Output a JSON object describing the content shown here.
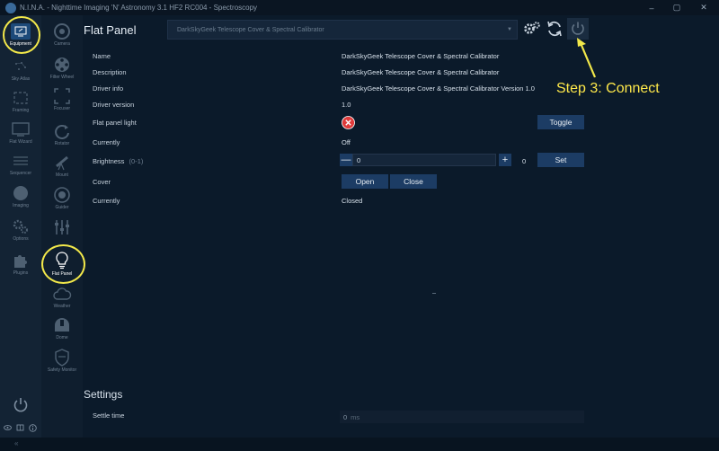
{
  "window": {
    "title": "N.I.N.A. - Nighttime Imaging 'N' Astronomy 3.1 HF2 RC004 - Spectroscopy",
    "minimize_glyph": "–",
    "maximize_glyph": "▢",
    "close_glyph": "✕"
  },
  "sidebar": {
    "items": [
      {
        "label": "Equipment",
        "icon": "equipment-icon"
      },
      {
        "label": "Sky Atlas",
        "icon": "sky-atlas-icon"
      },
      {
        "label": "Framing",
        "icon": "framing-icon"
      },
      {
        "label": "Flat Wizard",
        "icon": "flat-wizard-icon"
      },
      {
        "label": "Sequencer",
        "icon": "sequencer-icon"
      },
      {
        "label": "Imaging",
        "icon": "imaging-icon"
      },
      {
        "label": "Options",
        "icon": "options-icon"
      },
      {
        "label": "Plugins",
        "icon": "plugins-icon"
      }
    ]
  },
  "subnav": {
    "items": [
      {
        "label": "Camera",
        "icon": "camera-icon"
      },
      {
        "label": "Filter Wheel",
        "icon": "filter-wheel-icon"
      },
      {
        "label": "Focuser",
        "icon": "focuser-icon"
      },
      {
        "label": "Rotator",
        "icon": "rotator-icon"
      },
      {
        "label": "Mount",
        "icon": "mount-icon"
      },
      {
        "label": "Guider",
        "icon": "guider-icon"
      },
      {
        "label": "Switch",
        "icon": "switch-icon"
      },
      {
        "label": "Flat Panel",
        "icon": "lightbulb-icon"
      },
      {
        "label": "Weather",
        "icon": "cloud-icon"
      },
      {
        "label": "Dome",
        "icon": "dome-icon"
      },
      {
        "label": "Safety Monitor",
        "icon": "shield-icon"
      }
    ]
  },
  "header": {
    "title": "Flat Panel",
    "device_selected": "DarkSkyGeek Telescope Cover & Spectral Calibrator"
  },
  "properties": {
    "name_label": "Name",
    "name_value": "DarkSkyGeek Telescope Cover & Spectral Calibrator",
    "description_label": "Description",
    "description_value": "DarkSkyGeek Telescope Cover & Spectral Calibrator",
    "driver_info_label": "Driver info",
    "driver_info_value": "DarkSkyGeek Telescope Cover & Spectral Calibrator Version 1.0",
    "driver_version_label": "Driver version",
    "driver_version_value": "1.0",
    "light_label": "Flat panel light",
    "toggle_label": "Toggle",
    "currently_label": "Currently",
    "light_state": "Off",
    "brightness_label": "Brightness",
    "brightness_range": "(0-1)",
    "brightness_input": "0",
    "brightness_current": "0",
    "set_label": "Set",
    "cover_label": "Cover",
    "open_label": "Open",
    "close_label": "Close",
    "cover_currently_label": "Currently",
    "cover_state": "Closed"
  },
  "settings": {
    "title": "Settings",
    "settle_label": "Settle time",
    "settle_value": "0",
    "settle_unit": "ms"
  },
  "annotation": {
    "text": "Step 3: Connect",
    "color": "#ffe94a"
  },
  "colors": {
    "accent": "#1c3c64",
    "background": "#0b1a2a",
    "highlight_ring": "#f2e84a",
    "error_red": "#e03a3a"
  }
}
